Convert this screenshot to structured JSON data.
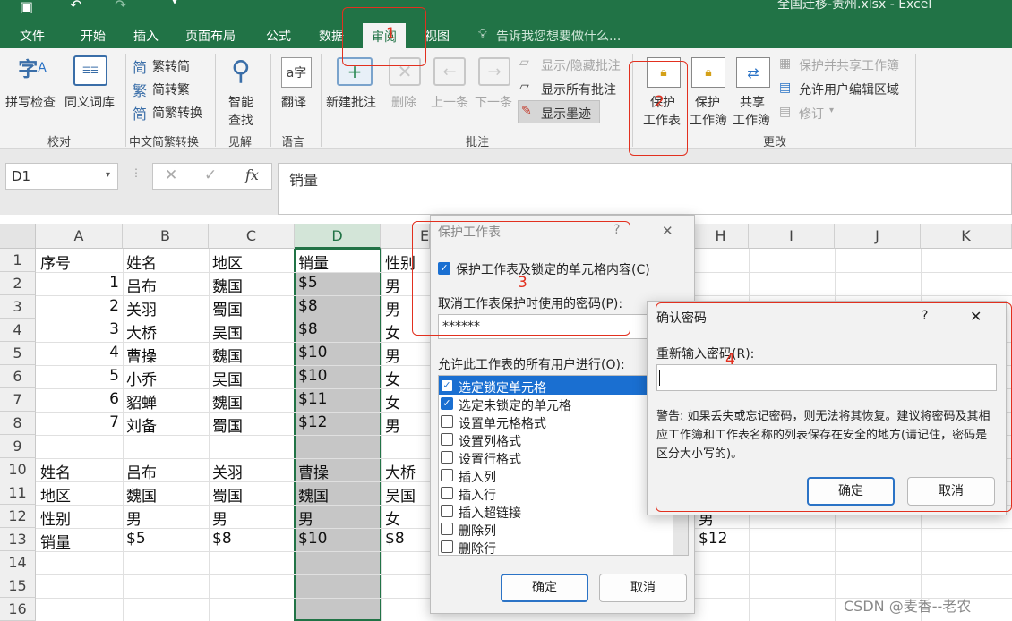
{
  "window": {
    "title": "全国迁移-贵州.xlsx - Excel"
  },
  "tabs": [
    {
      "label": "文件"
    },
    {
      "label": "开始"
    },
    {
      "label": "插入"
    },
    {
      "label": "页面布局"
    },
    {
      "label": "公式"
    },
    {
      "label": "数据"
    },
    {
      "label": "审阅"
    },
    {
      "label": "视图"
    }
  ],
  "tell_me": "告诉我您想要做什么...",
  "ribbon": {
    "spelling": "拼写检查",
    "thesaurus": "同义词库",
    "trad_to_simp": "繁转简",
    "simp_to_trad": "简转繁",
    "conversion": "简繁转换",
    "smart_lookup_1": "智能",
    "smart_lookup_2": "查找",
    "translate": "翻译",
    "new_comment": "新建批注",
    "delete": "删除",
    "previous": "上一条",
    "next": "下一条",
    "show_hide_comment": "显示/隐藏批注",
    "show_all_comments": "显示所有批注",
    "show_ink": "显示墨迹",
    "protect_sheet_1": "保护",
    "protect_sheet_2": "工作表",
    "protect_workbook_1": "保护",
    "protect_workbook_2": "工作簿",
    "share_workbook_1": "共享",
    "share_workbook_2": "工作簿",
    "protect_and_share": "保护并共享工作簿",
    "allow_edit_ranges": "允许用户编辑区域",
    "track_changes": "修订",
    "groups": {
      "proofing": "校对",
      "chinese_conversion": "中文简繁转换",
      "insights": "见解",
      "language": "语言",
      "comments": "批注",
      "changes": "更改"
    }
  },
  "formula_bar": {
    "name_box": "D1",
    "fx": "fx",
    "content": "销量"
  },
  "columns": [
    "A",
    "B",
    "C",
    "D",
    "E",
    "H",
    "I",
    "J",
    "K"
  ],
  "rows": [
    "1",
    "2",
    "3",
    "4",
    "5",
    "6",
    "7",
    "8",
    "9",
    "10",
    "11",
    "12",
    "13",
    "14",
    "15",
    "16"
  ],
  "cells": {
    "r1": [
      "序号",
      "姓名",
      "地区",
      "销量",
      "性别"
    ],
    "r2": [
      "1",
      "吕布",
      "魏国",
      "$5",
      "男"
    ],
    "r3": [
      "2",
      "关羽",
      "蜀国",
      "$8",
      "男"
    ],
    "r4": [
      "3",
      "大桥",
      "吴国",
      "$8",
      "女"
    ],
    "r5": [
      "4",
      "曹操",
      "魏国",
      "$10",
      "男"
    ],
    "r6": [
      "5",
      "小乔",
      "吴国",
      "$10",
      "女"
    ],
    "r7": [
      "6",
      "貂蝉",
      "魏国",
      "$11",
      "女"
    ],
    "r8": [
      "7",
      "刘备",
      "蜀国",
      "$12",
      "男"
    ],
    "r10": [
      "姓名",
      "吕布",
      "关羽",
      "曹操",
      "大桥"
    ],
    "r11": [
      "地区",
      "魏国",
      "蜀国",
      "魏国",
      "吴国"
    ],
    "r12": [
      "性别",
      "男",
      "男",
      "男",
      "女"
    ],
    "r13": [
      "销量",
      "$5",
      "$8",
      "$10",
      "$8"
    ],
    "h12": "男",
    "h13": "$12"
  },
  "protect_dialog": {
    "title": "保护工作表",
    "help": "?",
    "close": "✕",
    "protect_checkbox": "保护工作表及锁定的单元格内容(C)",
    "password_label": "取消工作表保护时使用的密码(P):",
    "password_value": "******",
    "allow_label": "允许此工作表的所有用户进行(O):",
    "options": [
      {
        "label": "选定锁定单元格",
        "checked": true
      },
      {
        "label": "选定未锁定的单元格",
        "checked": true
      },
      {
        "label": "设置单元格格式",
        "checked": false
      },
      {
        "label": "设置列格式",
        "checked": false
      },
      {
        "label": "设置行格式",
        "checked": false
      },
      {
        "label": "插入列",
        "checked": false
      },
      {
        "label": "插入行",
        "checked": false
      },
      {
        "label": "插入超链接",
        "checked": false
      },
      {
        "label": "删除列",
        "checked": false
      },
      {
        "label": "删除行",
        "checked": false
      }
    ],
    "ok": "确定",
    "cancel": "取消"
  },
  "confirm_dialog": {
    "title": "确认密码",
    "help": "?",
    "close": "✕",
    "reenter_label": "重新输入密码(R):",
    "password_value": "",
    "warning": "警告: 如果丢失或忘记密码，则无法将其恢复。建议将密码及其相应工作簿和工作表名称的列表保存在安全的地方(请记住，密码是区分大小写的)。",
    "ok": "确定",
    "cancel": "取消"
  },
  "annotations": [
    "1",
    "2",
    "3",
    "4"
  ],
  "watermark": "CSDN @麦香--老农",
  "colors": {
    "excel_green": "#217346",
    "annotation_red": "#e2301f",
    "accent_blue": "#1a6fd1"
  }
}
